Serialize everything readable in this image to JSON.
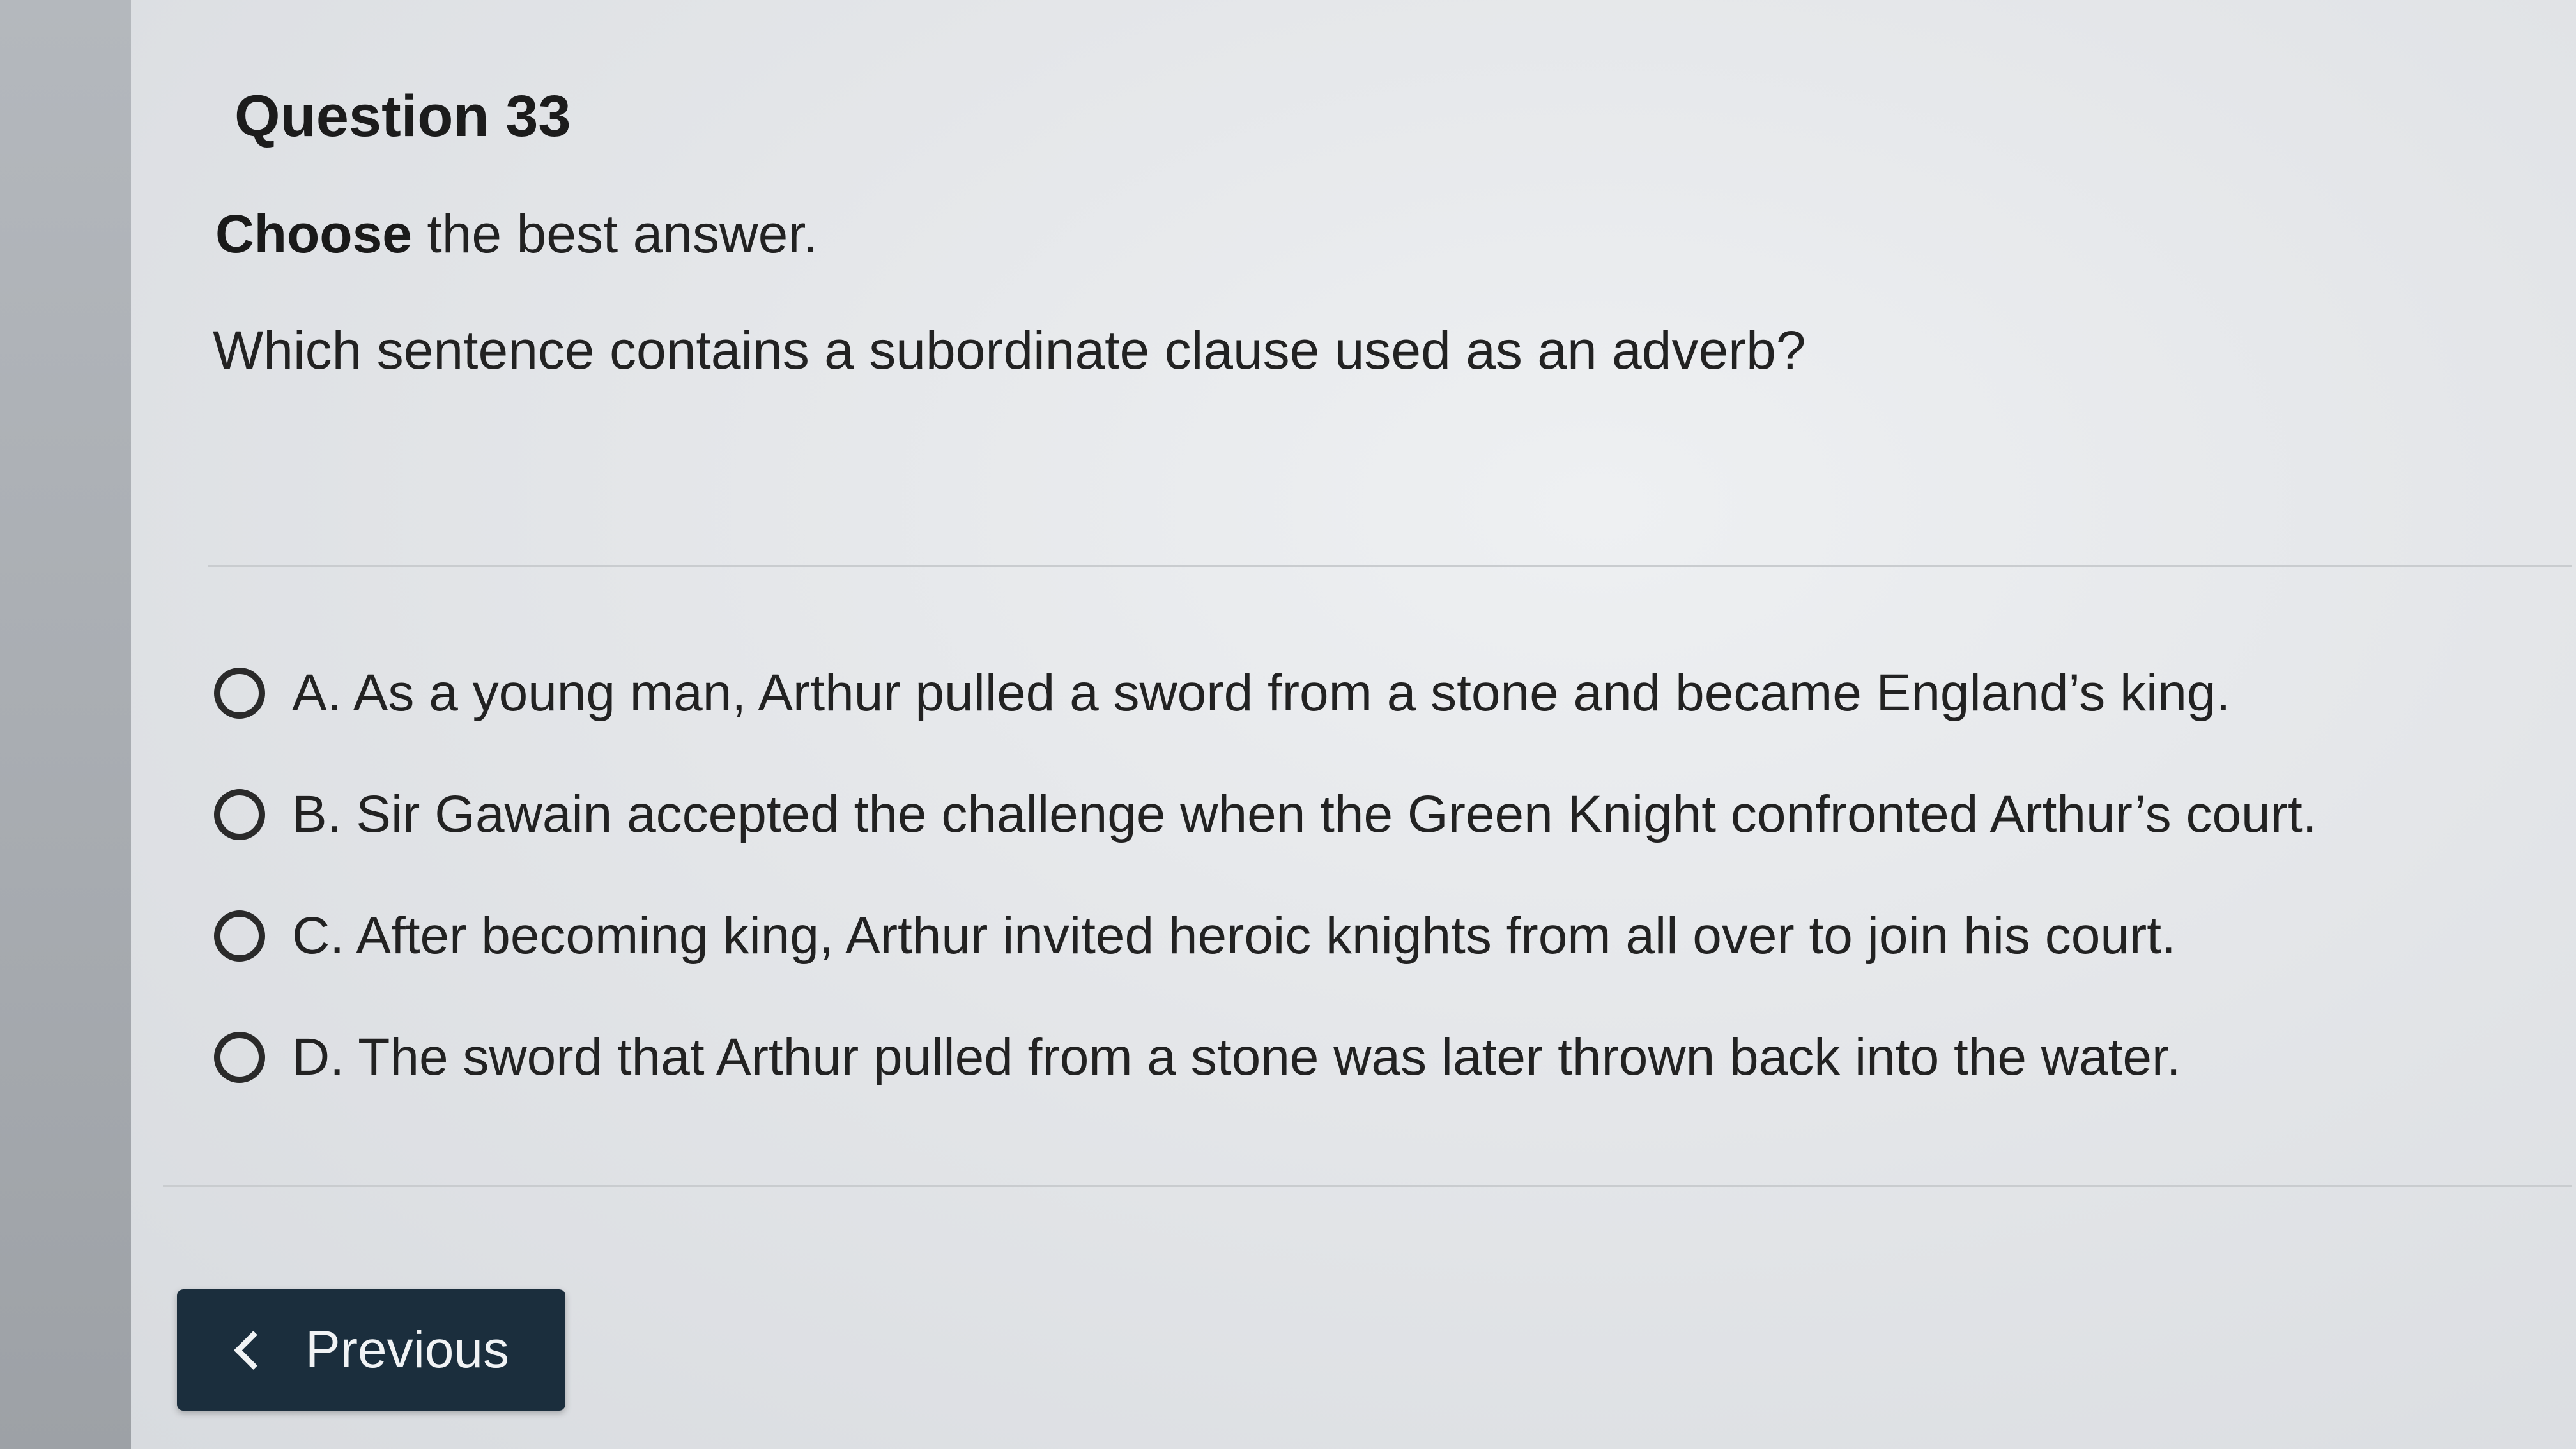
{
  "question": {
    "number_label": "Question 33",
    "instruction_bold": "Choose",
    "instruction_rest": " the best answer.",
    "prompt": "Which sentence contains a subordinate clause used as an adverb?"
  },
  "options": [
    {
      "text": "A. As a young man, Arthur pulled a sword from a stone and became England’s king."
    },
    {
      "text": "B. Sir Gawain accepted the challenge when the Green Knight confronted Arthur’s court."
    },
    {
      "text": "C. After becoming king, Arthur invited heroic knights from all over to join his court."
    },
    {
      "text": "D. The sword that Arthur pulled from a stone was later thrown back into the water."
    }
  ],
  "navigation": {
    "previous_label": "Previous",
    "previous_icon": "chevron-left-icon"
  },
  "colors": {
    "button_bg": "#1b2e3d",
    "button_text": "#f1f3f5",
    "text": "#222222"
  }
}
